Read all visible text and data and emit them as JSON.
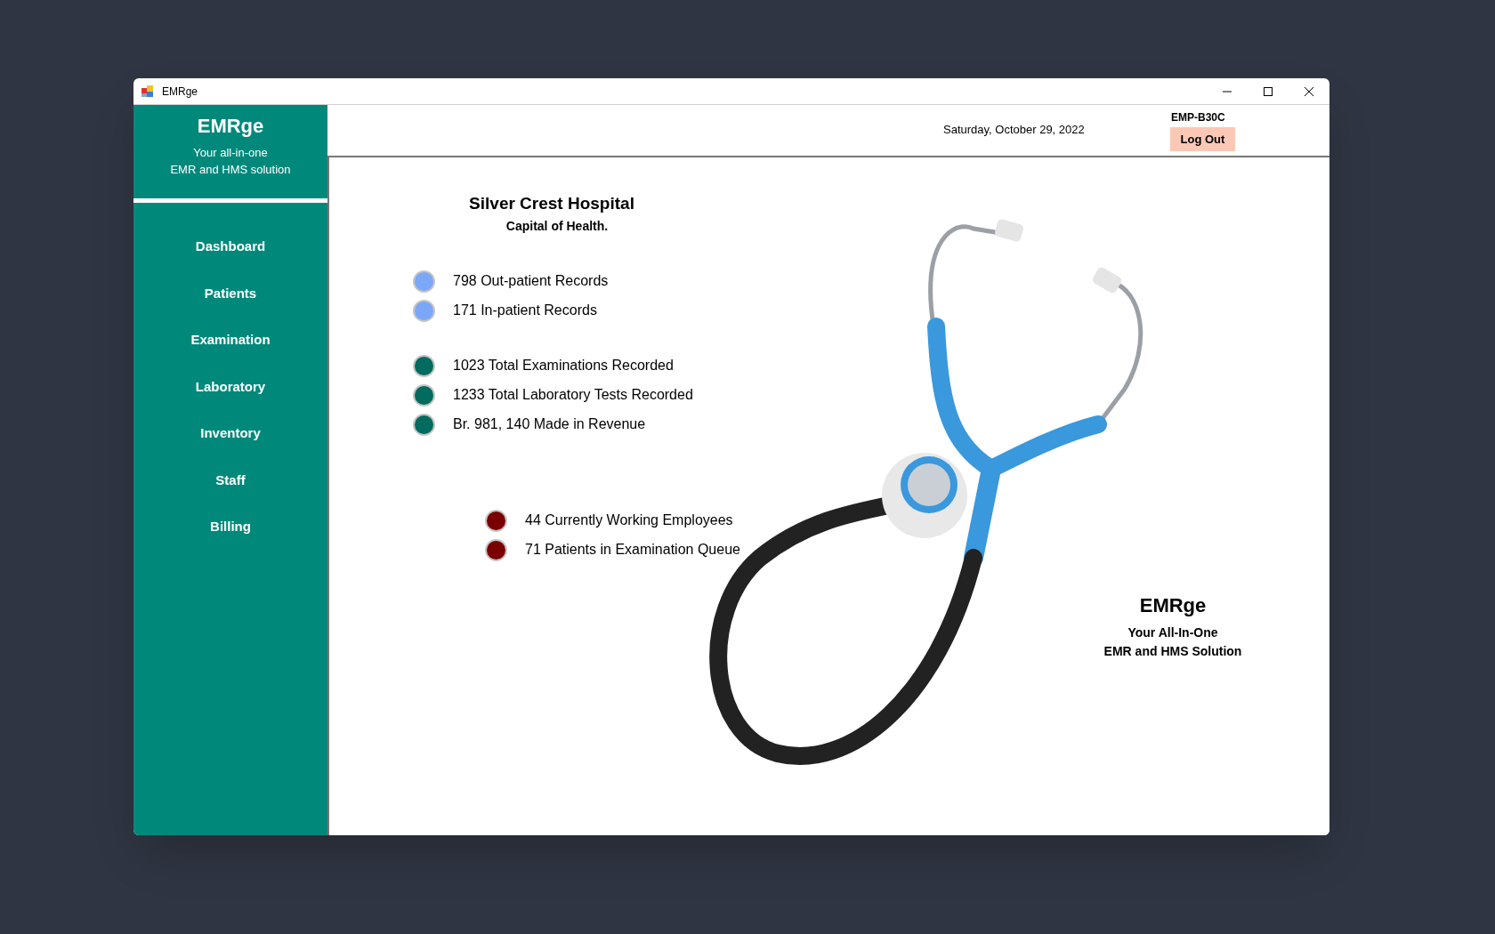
{
  "window": {
    "title": "EMRge"
  },
  "sidebar": {
    "brand": "EMRge",
    "tagline_lines": [
      "Your all-in-one",
      "EMR and HMS solution"
    ],
    "items": [
      {
        "label": "Dashboard",
        "selected": false
      },
      {
        "label": "Patients",
        "selected": false
      },
      {
        "label": "Examination",
        "selected": false
      },
      {
        "label": "Laboratory",
        "selected": false
      },
      {
        "label": "Inventory",
        "selected": false
      },
      {
        "label": "Staff",
        "selected": false
      },
      {
        "label": "Billing",
        "selected": false
      }
    ]
  },
  "header": {
    "date": "Saturday, October 29, 2022",
    "user_id": "EMP-B30C",
    "logout_button": "Log Out"
  },
  "hospital": {
    "name": "Silver Crest Hospital",
    "slogan": "Capital of Health."
  },
  "stat_groups": [
    {
      "items": [
        {
          "text": "798 Out-patient Records",
          "color": "#7aa7f7"
        },
        {
          "text": "171 In-patient Records",
          "color": "#7aa7f7"
        }
      ]
    },
    {
      "items": [
        {
          "text": "1023 Total Examinations Recorded",
          "color": "#006b5e"
        },
        {
          "text": "1233 Total Laboratory Tests Recorded",
          "color": "#006b5e"
        },
        {
          "text": "Br. 981, 140 Made in Revenue",
          "color": "#006b5e"
        }
      ]
    },
    {
      "items": [
        {
          "text": "44 Currently Working Employees",
          "color": "#7a0000"
        },
        {
          "text": "71 Patients in Examination Queue",
          "color": "#7a0000"
        }
      ]
    }
  ],
  "branding": {
    "name": "EMRge",
    "tagline_lines": [
      "Your All-In-One",
      "EMR and HMS Solution"
    ]
  }
}
